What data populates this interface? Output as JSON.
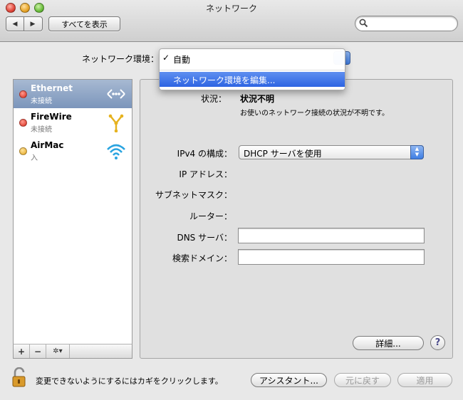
{
  "window": {
    "title": "ネットワーク"
  },
  "toolbar": {
    "back_symbol": "◀",
    "forward_symbol": "▶",
    "show_all_label": "すべてを表示",
    "search_placeholder": ""
  },
  "location": {
    "label": "ネットワーク環境：",
    "menu": {
      "checkmark": "✓",
      "selected_label": "自動",
      "edit_label": "ネットワーク環境を編集..."
    }
  },
  "sidebar": {
    "services": [
      {
        "name": "Ethernet",
        "status": "未接続",
        "status_color": "red",
        "icon": "ethernet-icon",
        "selected": true
      },
      {
        "name": "FireWire",
        "status": "未接続",
        "status_color": "red",
        "icon": "firewire-icon",
        "selected": false
      },
      {
        "name": "AirMac",
        "status": "入",
        "status_color": "yellow",
        "icon": "wifi-icon",
        "selected": false
      }
    ],
    "bottom": {
      "add": "+",
      "remove": "−",
      "action": "✲▾"
    }
  },
  "details": {
    "status_label": "状況：",
    "status_value": "状況不明",
    "status_desc": "お使いのネットワーク接続の状況が不明です。",
    "ipv4_label": "IPv4 の構成：",
    "ipv4_value": "DHCP サーバを使用",
    "ip_label": "IP アドレス：",
    "subnet_label": "サブネットマスク：",
    "router_label": "ルーター：",
    "dns_label": "DNS サーバ：",
    "dns_value": "",
    "search_domain_label": "検索ドメイン：",
    "search_domain_value": "",
    "advanced_label": "詳細...",
    "help_label": "?"
  },
  "footer": {
    "lock_text": "変更できないようにするにはカギをクリックします。",
    "assistant_label": "アシスタント...",
    "revert_label": "元に戻す",
    "apply_label": "適用"
  },
  "colors": {
    "selection": "#2d64e2",
    "sidebar_selected": "#7b95bb"
  }
}
